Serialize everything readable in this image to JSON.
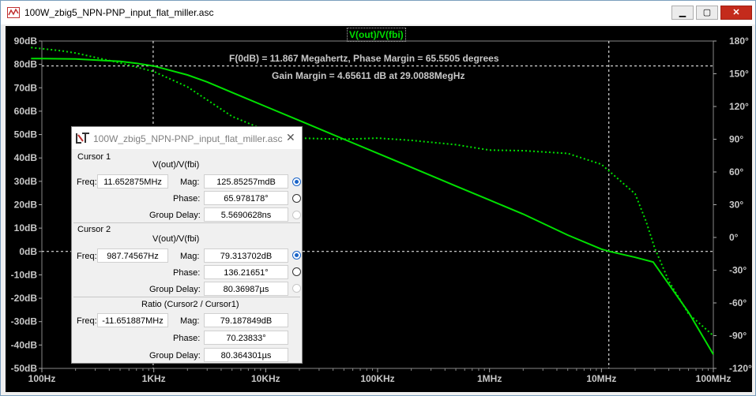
{
  "window": {
    "title": "100W_zbig5_NPN-PNP_input_flat_miller.asc",
    "min_glyph": "▁",
    "max_glyph": "▢",
    "close_glyph": "✕"
  },
  "plot": {
    "trace_label": "V(out)/V(fbi)",
    "info_line1": "F(0dB) = 11.867 Megahertz, Phase Margin = 65.5505 degrees",
    "info_line2": "Gain Margin = 4.65611 dB at 29.0088MegHz",
    "colors": {
      "background": "#000000",
      "trace": "#00e000",
      "axis_text": "#c8c8c8",
      "grid": "#ffffff"
    }
  },
  "chart_data": {
    "type": "line",
    "x_scale": "log",
    "xlim": [
      100,
      100000000
    ],
    "x_ticks": [
      "100Hz",
      "1KHz",
      "10KHz",
      "100KHz",
      "1MHz",
      "10MHz",
      "100MHz"
    ],
    "y_left_ticks": [
      "90dB",
      "80dB",
      "70dB",
      "60dB",
      "50dB",
      "40dB",
      "30dB",
      "20dB",
      "10dB",
      "0dB",
      "-10dB",
      "-20dB",
      "-30dB",
      "-40dB",
      "-50dB"
    ],
    "y_left_lim": [
      -50,
      90
    ],
    "y_right_ticks": [
      "180°",
      "150°",
      "120°",
      "90°",
      "60°",
      "30°",
      "0°",
      "-30°",
      "-60°",
      "-90°",
      "-120°"
    ],
    "y_right_lim": [
      -120,
      180
    ],
    "series": [
      {
        "name": "V(out)/V(fbi)",
        "style": "solid",
        "axis": "left",
        "points": [
          [
            80,
            82.5
          ],
          [
            100,
            82.5
          ],
          [
            200,
            82.3
          ],
          [
            500,
            81.3
          ],
          [
            700,
            80.5
          ],
          [
            1000,
            79.3
          ],
          [
            2000,
            75.5
          ],
          [
            3000,
            72.5
          ],
          [
            5000,
            68
          ],
          [
            10000,
            62
          ],
          [
            20000,
            56
          ],
          [
            50000,
            48
          ],
          [
            100000,
            42
          ],
          [
            200000,
            36
          ],
          [
            500000,
            28
          ],
          [
            1000000,
            22
          ],
          [
            2000000,
            16
          ],
          [
            5000000,
            7
          ],
          [
            10000000,
            1
          ],
          [
            11867000,
            0
          ],
          [
            20000000,
            -2.5
          ],
          [
            29000000,
            -4.5
          ],
          [
            40000000,
            -14
          ],
          [
            60000000,
            -26
          ],
          [
            100000000,
            -44
          ]
        ]
      },
      {
        "name": "Phase",
        "style": "dotted",
        "axis": "right",
        "points": [
          [
            80,
            174
          ],
          [
            100,
            173
          ],
          [
            150,
            171
          ],
          [
            200,
            169
          ],
          [
            300,
            165
          ],
          [
            500,
            160
          ],
          [
            1000,
            152
          ],
          [
            2000,
            138
          ],
          [
            3000,
            126
          ],
          [
            5000,
            111
          ],
          [
            10000,
            98
          ],
          [
            20000,
            91
          ],
          [
            50000,
            90
          ],
          [
            100000,
            91
          ],
          [
            200000,
            89
          ],
          [
            500000,
            85
          ],
          [
            1000000,
            80
          ],
          [
            2000000,
            79.5
          ],
          [
            5000000,
            77
          ],
          [
            10000000,
            67
          ],
          [
            20000000,
            40
          ],
          [
            25000000,
            15
          ],
          [
            30000000,
            -10
          ],
          [
            40000000,
            -40
          ],
          [
            60000000,
            -70
          ],
          [
            100000000,
            -90
          ]
        ]
      }
    ],
    "cursors": {
      "x1": 11652875,
      "x2": 987.74567,
      "y_db": [
        0,
        79.313702
      ]
    }
  },
  "dialog": {
    "title": "100W_zbig5_NPN-PNP_input_flat_miller.asc",
    "close_glyph": "✕",
    "cursor1": {
      "heading": "Cursor 1",
      "trace": "V(out)/V(fbi)",
      "freq_label": "Freq:",
      "freq": "11.652875MHz",
      "mag_label": "Mag:",
      "mag": "125.85257mdB",
      "phase_label": "Phase:",
      "phase": "65.978178°",
      "gd_label": "Group Delay:",
      "gd": "5.5690628ns"
    },
    "cursor2": {
      "heading": "Cursor 2",
      "trace": "V(out)/V(fbi)",
      "freq_label": "Freq:",
      "freq": "987.74567Hz",
      "mag_label": "Mag:",
      "mag": "79.313702dB",
      "phase_label": "Phase:",
      "phase": "136.21651°",
      "gd_label": "Group Delay:",
      "gd": "80.36987µs"
    },
    "ratio": {
      "heading": "Ratio (Cursor2 / Cursor1)",
      "freq_label": "Freq:",
      "freq": "-11.651887MHz",
      "mag_label": "Mag:",
      "mag": "79.187849dB",
      "phase_label": "Phase:",
      "phase": "70.23833°",
      "gd_label": "Group Delay:",
      "gd": "80.364301µs"
    }
  }
}
